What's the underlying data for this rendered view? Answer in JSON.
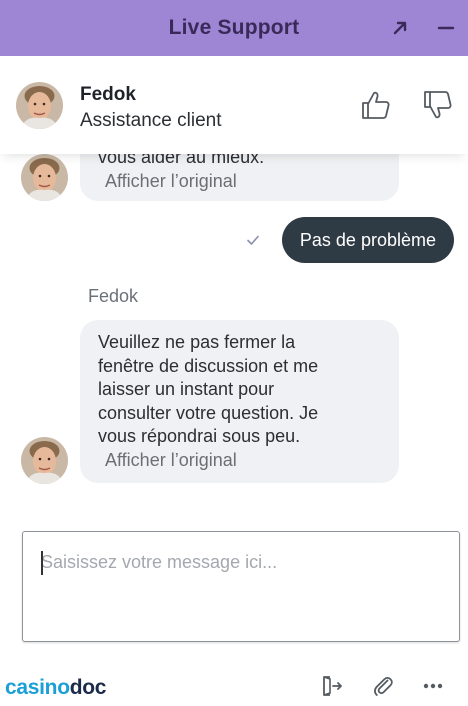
{
  "window": {
    "title": "Live Support",
    "expand_icon": "expand-arrow-icon",
    "minimize_icon": "minimize-icon"
  },
  "agent": {
    "name": "Fedok",
    "role": "Assistance client",
    "rate_up_icon": "thumbs-up-icon",
    "rate_down_icon": "thumbs-down-icon"
  },
  "messages": [
    {
      "from": "agent",
      "text": "vous aider au mieux.",
      "link": "Afficher l’original"
    },
    {
      "from": "visitor",
      "text": "Pas de problème",
      "status_icon": "check-icon"
    },
    {
      "from": "agent",
      "sender": "Fedok",
      "text": "Veuillez ne pas fermer la\nfenêtre de discussion et me\nlaisser un instant pour\nconsulter votre question. Je\nvous répondrai sous peu.",
      "link": "Afficher l’original"
    }
  ],
  "composer": {
    "placeholder": "Saisissez votre message ici...",
    "value": ""
  },
  "footer": {
    "brand_part1": "casino",
    "brand_part2": "doc",
    "icons": [
      "exit-icon",
      "paperclip-icon",
      "more-options-icon"
    ]
  },
  "colors": {
    "header": "#9f86d4",
    "agent_bubble": "#f0f1f4",
    "visitor_bubble": "#2e3a44",
    "brand_blue": "#1aa0d6",
    "brand_navy": "#1c2b4a"
  }
}
